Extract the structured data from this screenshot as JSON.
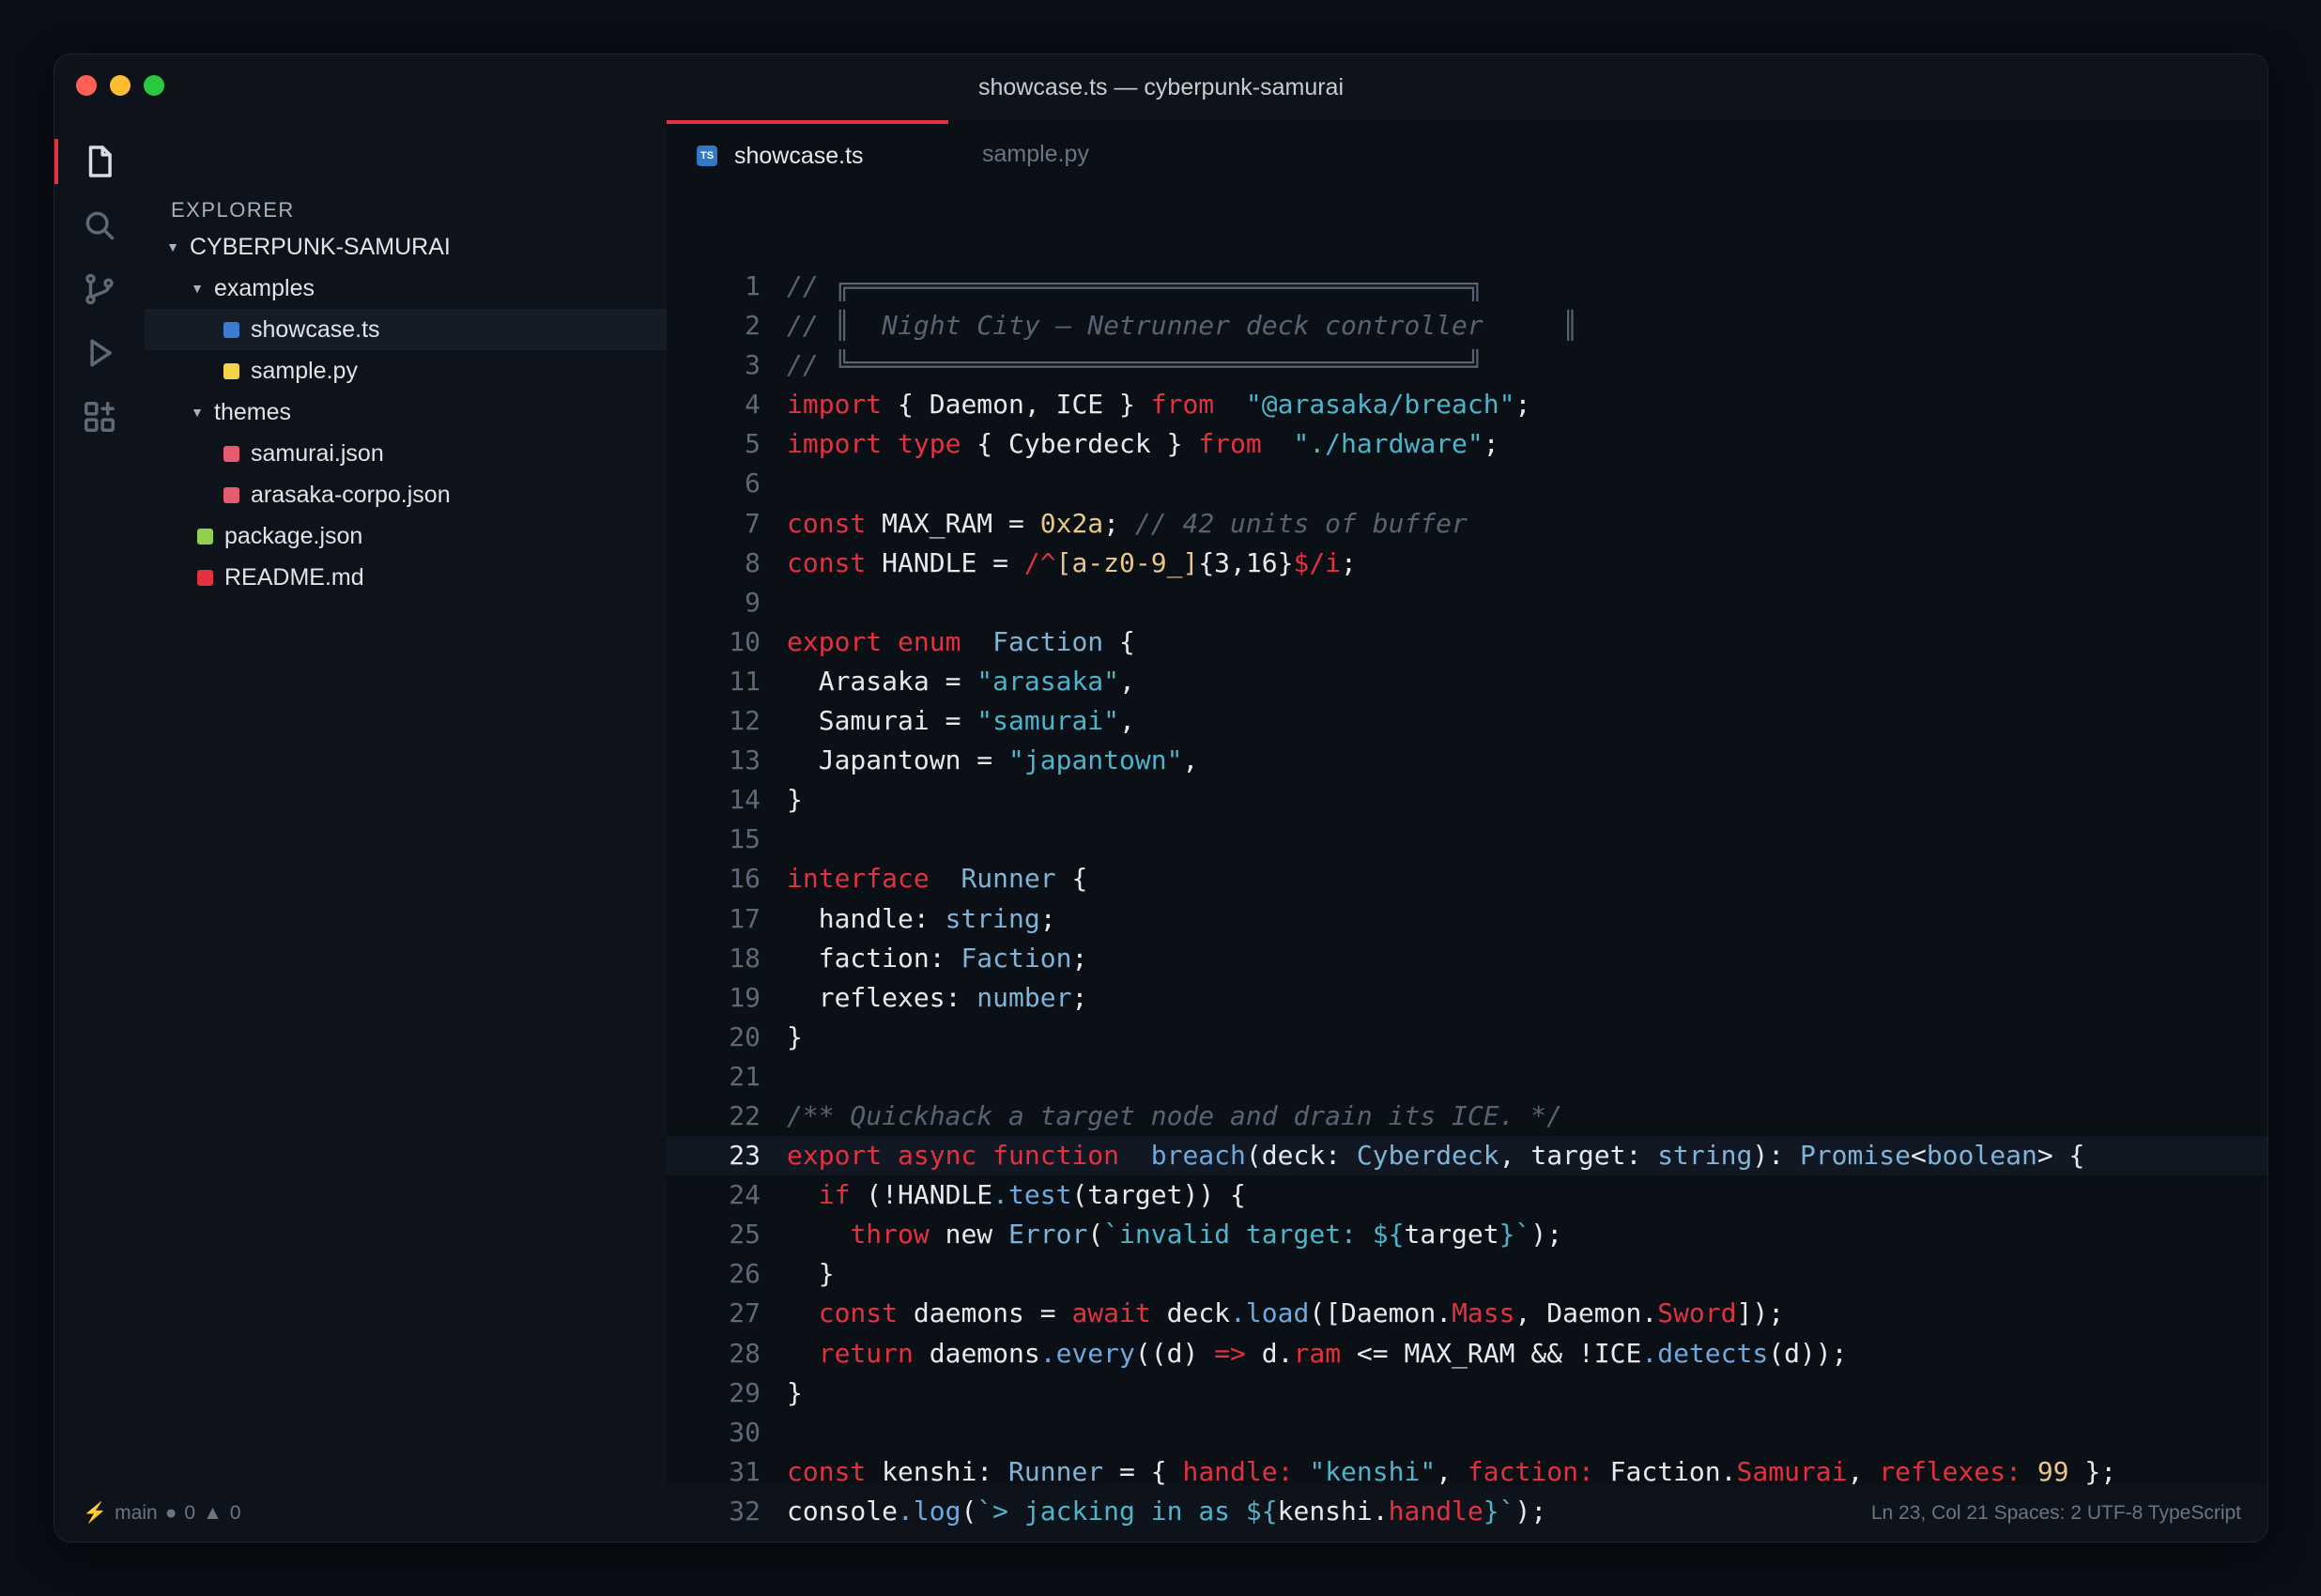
{
  "window": {
    "title": "showcase.ts — cyberpunk-samurai"
  },
  "activity_bar": {
    "icons": [
      "files-icon",
      "search-icon",
      "source-control-icon",
      "run-debug-icon",
      "extensions-icon"
    ]
  },
  "sidebar": {
    "title": "EXPLORER",
    "root": "CYBERPUNK-SAMURAI",
    "folders": {
      "examples": "examples",
      "themes": "themes"
    },
    "files": {
      "showcase": {
        "name": "showcase.ts",
        "color": "#3a7bd5"
      },
      "sample": {
        "name": "sample.py",
        "color": "#f5d547"
      },
      "samurai": {
        "name": "samurai.json",
        "color": "#e85a70"
      },
      "arasaka": {
        "name": "arasaka-corpo.json",
        "color": "#e85a70"
      },
      "package": {
        "name": "package.json",
        "color": "#8fd14f"
      },
      "readme": {
        "name": "README.md",
        "color": "#e2323f"
      }
    }
  },
  "tabs": {
    "active": {
      "label": "showcase.ts",
      "badge": "TS"
    },
    "inactive": {
      "label": "sample.py"
    }
  },
  "editor": {
    "current_line": 23,
    "lines": [
      [
        [
          "c-com",
          "// ╔═══════════════════════════════════════╗"
        ]
      ],
      [
        [
          "c-com",
          "// ║  Night City — Netrunner deck controller     ║"
        ]
      ],
      [
        [
          "c-com",
          "// ╚═══════════════════════════════════════╝"
        ]
      ],
      [
        [
          "c-kw",
          "import"
        ],
        [
          "",
          "{ Daemon, ICE } "
        ],
        [
          "c-kw",
          "from"
        ],
        [
          "",
          ""
        ],
        [
          "c-str",
          "\"@arasaka/breach\""
        ],
        [
          "",
          ";"
        ]
      ],
      [
        [
          "c-kw",
          "import type"
        ],
        [
          "",
          "{ Cyberdeck } "
        ],
        [
          "c-kw",
          "from"
        ],
        [
          "",
          ""
        ],
        [
          "c-str",
          "\"./hardware\""
        ],
        [
          "",
          ";"
        ]
      ],
      [],
      [
        [
          "c-kw",
          "const"
        ],
        [
          "",
          "MAX_RAM = "
        ],
        [
          "c-num",
          "0x2a"
        ],
        [
          "",
          "; "
        ],
        [
          "c-com",
          "// 42 units of buffer"
        ]
      ],
      [
        [
          "c-kw",
          "const"
        ],
        [
          "",
          "HANDLE = "
        ],
        [
          "c-kw",
          "/^"
        ],
        [
          "c-rx",
          "[a-z0-9_]"
        ],
        [
          "",
          "{3,16}"
        ],
        [
          "c-kw",
          "$/i"
        ],
        [
          "",
          ";"
        ]
      ],
      [],
      [
        [
          "c-kw",
          "export enum"
        ],
        [
          "",
          ""
        ],
        [
          "c-type",
          "Faction"
        ],
        [
          "",
          " {"
        ]
      ],
      [
        [
          "",
          "  Arasaka = "
        ],
        [
          "c-str",
          "\"arasaka\""
        ],
        [
          "",
          ","
        ]
      ],
      [
        [
          "",
          "  Samurai = "
        ],
        [
          "c-str",
          "\"samurai\""
        ],
        [
          "",
          ","
        ]
      ],
      [
        [
          "",
          "  Japantown = "
        ],
        [
          "c-str",
          "\"japantown\""
        ],
        [
          "",
          ","
        ]
      ],
      [
        [
          "",
          "}"
        ]
      ],
      [],
      [
        [
          "c-kw",
          "interface"
        ],
        [
          "",
          ""
        ],
        [
          "c-type",
          "Runner"
        ],
        [
          "",
          " {"
        ]
      ],
      [
        [
          "",
          "  handle: "
        ],
        [
          "c-type",
          "string"
        ],
        [
          "",
          ";"
        ]
      ],
      [
        [
          "",
          "  faction: "
        ],
        [
          "c-type",
          "Faction"
        ],
        [
          "",
          ";"
        ]
      ],
      [
        [
          "",
          "  reflexes: "
        ],
        [
          "c-type",
          "number"
        ],
        [
          "",
          ";"
        ]
      ],
      [
        [
          "",
          "}"
        ]
      ],
      [],
      [
        [
          "c-com",
          "/** Quickhack a target node and drain its ICE. */"
        ]
      ],
      [
        [
          "c-kw",
          "export async function"
        ],
        [
          "",
          ""
        ],
        [
          "c-fn",
          "breach"
        ],
        [
          "",
          "(deck: "
        ],
        [
          "c-type",
          "Cyberdeck"
        ],
        [
          "",
          ", target: "
        ],
        [
          "c-type",
          "string"
        ],
        [
          "",
          "): "
        ],
        [
          "c-type",
          "Promise"
        ],
        [
          "",
          "<"
        ],
        [
          "c-type",
          "boolean"
        ],
        [
          "",
          "> {"
        ]
      ],
      [
        [
          "",
          "  "
        ],
        [
          "c-kw",
          "if"
        ],
        [
          "",
          " (!HANDLE"
        ],
        [
          "c-fn",
          ".test"
        ],
        [
          "",
          "(target)) {"
        ]
      ],
      [
        [
          "",
          "    "
        ],
        [
          "c-kw",
          "throw"
        ],
        [
          "",
          " new "
        ],
        [
          "c-type",
          "Error"
        ],
        [
          "",
          "("
        ],
        [
          "c-tpl",
          "`invalid target: ${"
        ],
        [
          "",
          "target"
        ],
        [
          "c-tpl",
          "}`"
        ],
        [
          "",
          ");"
        ]
      ],
      [
        [
          "",
          "  }"
        ]
      ],
      [
        [
          "",
          "  "
        ],
        [
          "c-kw",
          "const"
        ],
        [
          "",
          " daemons = "
        ],
        [
          "c-kw",
          "await"
        ],
        [
          "",
          " deck"
        ],
        [
          "c-fn",
          ".load"
        ],
        [
          "",
          "([Daemon."
        ],
        [
          "c-prop",
          "Mass"
        ],
        [
          "",
          ", Daemon."
        ],
        [
          "c-prop",
          "Sword"
        ],
        [
          "",
          "]);"
        ]
      ],
      [
        [
          "",
          "  "
        ],
        [
          "c-kw",
          "return"
        ],
        [
          "",
          " daemons"
        ],
        [
          "c-fn",
          ".every"
        ],
        [
          "",
          "((d) "
        ],
        [
          "c-kw",
          "=>"
        ],
        [
          "",
          " d."
        ],
        [
          "c-prop",
          "ram"
        ],
        [
          "",
          " <= MAX_RAM && !ICE"
        ],
        [
          "c-fn",
          ".detects"
        ],
        [
          "",
          "(d));"
        ]
      ],
      [
        [
          "",
          "}"
        ]
      ],
      [],
      [
        [
          "c-kw",
          "const"
        ],
        [
          "",
          " kenshi: "
        ],
        [
          "c-type",
          "Runner"
        ],
        [
          "",
          " = { "
        ],
        [
          "c-prop",
          "handle:"
        ],
        [
          "",
          ""
        ],
        [
          "c-str",
          "\"kenshi\""
        ],
        [
          "",
          ", "
        ],
        [
          "c-prop",
          "faction:"
        ],
        [
          "",
          " Faction."
        ],
        [
          "c-prop",
          "Samurai"
        ],
        [
          "",
          ", "
        ],
        [
          "c-prop",
          "reflexes:"
        ],
        [
          "",
          ""
        ],
        [
          "c-num",
          "99"
        ],
        [
          "",
          " };"
        ]
      ],
      [
        [
          "",
          "console"
        ],
        [
          "c-fn",
          ".log"
        ],
        [
          "",
          "("
        ],
        [
          "c-tpl",
          "`> jacking in as ${"
        ],
        [
          "",
          "kenshi."
        ],
        [
          "c-prop",
          "handle"
        ],
        [
          "c-tpl",
          "}`"
        ],
        [
          "",
          ");"
        ]
      ]
    ]
  },
  "status": {
    "branch": "main",
    "errors": "0",
    "warnings": "0",
    "right": "Ln 23, Col 21  Spaces: 2  UTF-8  TypeScript"
  }
}
